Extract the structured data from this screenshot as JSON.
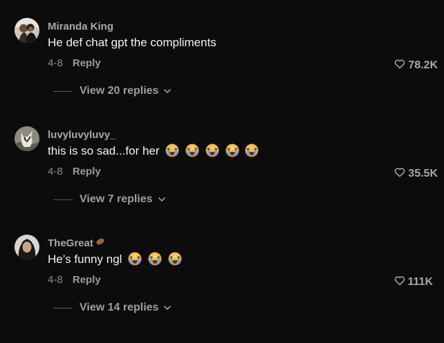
{
  "comments": [
    {
      "username": "Miranda King",
      "text": "He def chat gpt the compliments",
      "emoji_count": 0,
      "date": "4-8",
      "reply_label": "Reply",
      "likes": "78.2K",
      "view_replies": "View 20 replies",
      "avatar_icon": "profile-photo-couple"
    },
    {
      "username": "luvyluvyluvy_",
      "text": "this is so sad...for her",
      "emoji_count": 5,
      "emoji": "loudly-crying-face-icon",
      "date": "4-8",
      "reply_label": "Reply",
      "likes": "35.5K",
      "view_replies": "View 7 replies",
      "avatar_icon": "profile-photo-animal"
    },
    {
      "username": "TheGreat",
      "badge_icon": "bronze-leaf-badge-icon",
      "text": "He’s funny ngl",
      "emoji_count": 3,
      "emoji": "loudly-crying-face-icon",
      "date": "4-8",
      "reply_label": "Reply",
      "likes": "111K",
      "view_replies": "View 14 replies",
      "avatar_icon": "profile-photo-person"
    }
  ],
  "colors": {
    "background": "#0c0c0c",
    "username": "#a8a8a8",
    "comment_text": "#f2f2f2",
    "meta": "#8c8c8c"
  }
}
